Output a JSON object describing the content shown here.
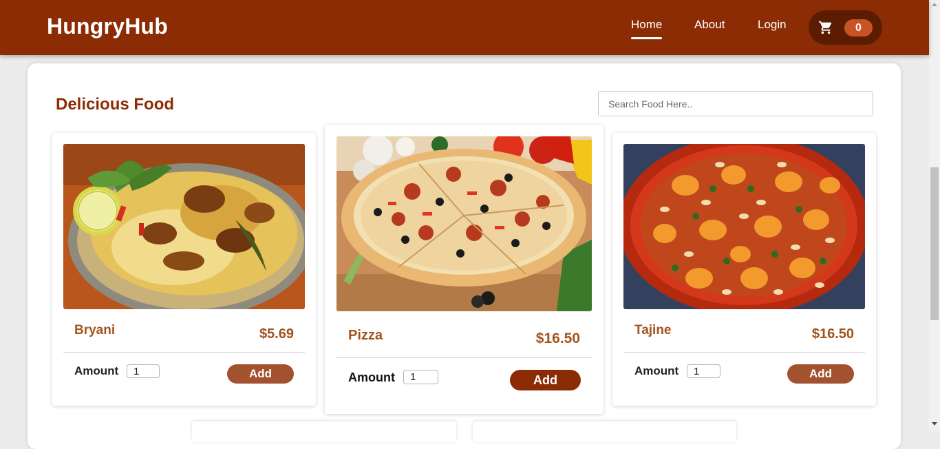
{
  "app": {
    "title": "HungryHub"
  },
  "nav": {
    "home": "Home",
    "about": "About",
    "login": "Login"
  },
  "cart": {
    "count": "0",
    "icon": "shopping-cart-icon"
  },
  "section": {
    "title": "Delicious Food"
  },
  "search": {
    "placeholder": "Search Food Here..",
    "value": ""
  },
  "foods": [
    {
      "name": "Bryani",
      "price": "$5.69",
      "amount_label": "Amount",
      "amount": "1",
      "add_label": "Add"
    },
    {
      "name": "Pizza",
      "price": "$16.50",
      "amount_label": "Amount",
      "amount": "1",
      "add_label": "Add"
    },
    {
      "name": "Tajine",
      "price": "$16.50",
      "amount_label": "Amount",
      "amount": "1",
      "add_label": "Add"
    }
  ],
  "colors": {
    "brand": "#8c2c04",
    "cart_pill": "#5c1c02",
    "cart_badge": "#c85426",
    "accent_text": "#a3531d",
    "add_button": "#a3522f",
    "add_button_active": "#8c2c04"
  }
}
